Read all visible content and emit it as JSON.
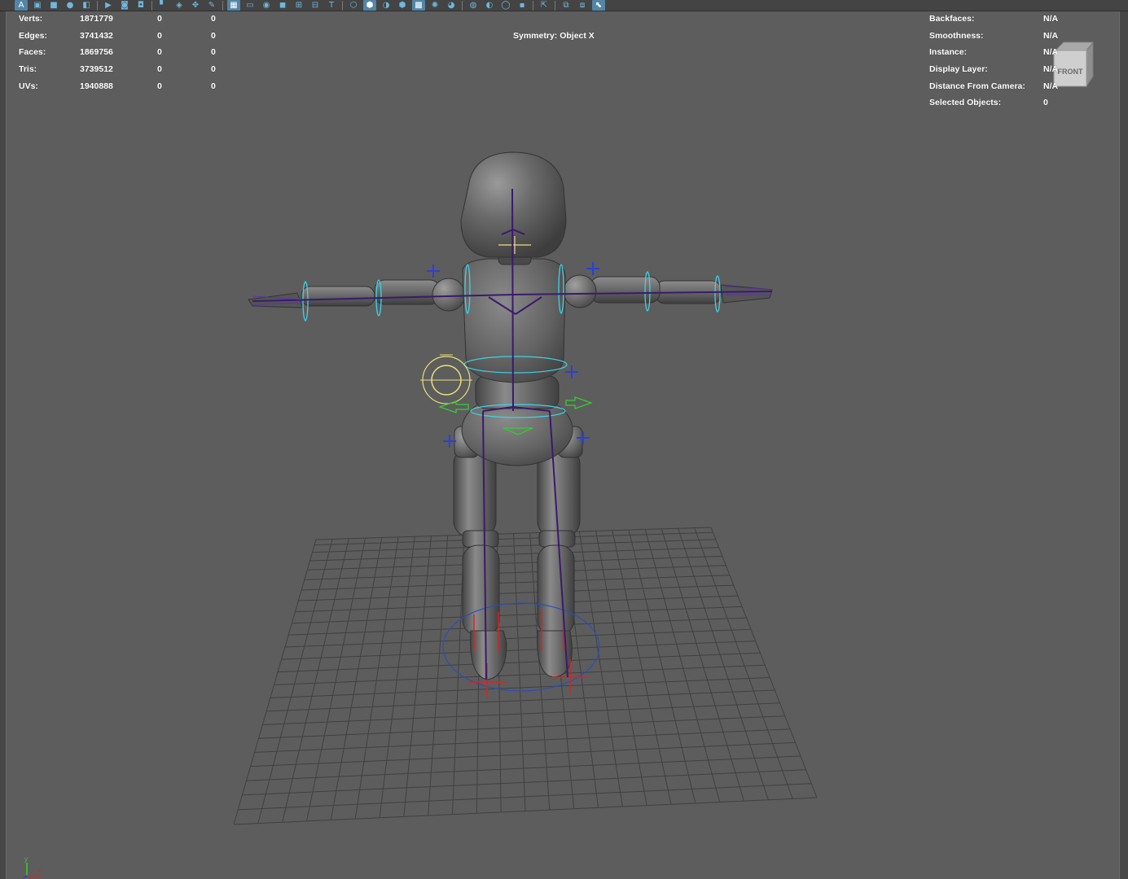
{
  "toolbar": {
    "buttons": [
      {
        "icon": "select-mode-icon",
        "glyph": "A",
        "active": true
      },
      {
        "icon": "frame-icon",
        "glyph": "▣",
        "active": false
      },
      {
        "icon": "panel-icon",
        "glyph": "■",
        "active": false
      },
      {
        "icon": "sphere-icon",
        "glyph": "●",
        "active": false
      },
      {
        "icon": "layers-icon",
        "glyph": "◧",
        "active": false
      },
      {
        "sep": true
      },
      {
        "icon": "camera-icon",
        "glyph": "▶",
        "active": false
      },
      {
        "icon": "camera-lock-icon",
        "glyph": "◙",
        "active": false
      },
      {
        "icon": "camera-attr-icon",
        "glyph": "◘",
        "active": false
      },
      {
        "sep": true
      },
      {
        "icon": "bookmark-icon",
        "glyph": "▘",
        "active": false
      },
      {
        "icon": "image-plane-icon",
        "glyph": "◈",
        "active": false
      },
      {
        "icon": "2d-pan-icon",
        "glyph": "✥",
        "active": false
      },
      {
        "icon": "grease-pencil-icon",
        "glyph": "✎",
        "active": false
      },
      {
        "sep": true
      },
      {
        "icon": "grid-icon",
        "glyph": "▦",
        "active": true
      },
      {
        "icon": "film-gate-icon",
        "glyph": "▭",
        "active": false
      },
      {
        "icon": "resolution-gate-icon",
        "glyph": "◉",
        "active": false
      },
      {
        "icon": "gate-mask-icon",
        "glyph": "◼",
        "active": false
      },
      {
        "icon": "field-chart-icon",
        "glyph": "⊞",
        "active": false
      },
      {
        "icon": "safe-action-icon",
        "glyph": "⊟",
        "active": false
      },
      {
        "icon": "safe-title-icon",
        "glyph": "T",
        "active": false
      },
      {
        "sep": true
      },
      {
        "icon": "wireframe-icon",
        "glyph": "⬡",
        "active": false
      },
      {
        "icon": "smooth-shade-icon",
        "glyph": "⬢",
        "active": true
      },
      {
        "icon": "wireframe-on-shaded-icon",
        "glyph": "◑",
        "active": false
      },
      {
        "icon": "textured-icon",
        "glyph": "⬢",
        "active": false
      },
      {
        "icon": "checker-icon",
        "glyph": "▩",
        "active": true
      },
      {
        "icon": "lights-icon",
        "glyph": "✺",
        "active": false
      },
      {
        "icon": "shadows-icon",
        "glyph": "◕",
        "active": false
      },
      {
        "sep": true
      },
      {
        "icon": "ambient-occlusion-icon",
        "glyph": "◍",
        "active": false
      },
      {
        "icon": "motion-blur-icon",
        "glyph": "◐",
        "active": false
      },
      {
        "icon": "anti-aliasing-icon",
        "glyph": "◯",
        "active": false
      },
      {
        "icon": "depth-of-field-icon",
        "glyph": "▪",
        "active": false
      },
      {
        "sep": true
      },
      {
        "icon": "isolate-select-icon",
        "glyph": "⇱",
        "active": false
      },
      {
        "sep": true
      },
      {
        "icon": "xray-icon",
        "glyph": "⧉",
        "active": false
      },
      {
        "icon": "xray-joints-icon",
        "glyph": "⧈",
        "active": false
      },
      {
        "icon": "xray-active-icon",
        "glyph": "⬉",
        "active": true
      }
    ]
  },
  "hud_left": {
    "rows": [
      {
        "label": "Verts:",
        "v1": "1871779",
        "v2": "0",
        "v3": "0"
      },
      {
        "label": "Edges:",
        "v1": "3741432",
        "v2": "0",
        "v3": "0"
      },
      {
        "label": "Faces:",
        "v1": "1869756",
        "v2": "0",
        "v3": "0"
      },
      {
        "label": "Tris:",
        "v1": "3739512",
        "v2": "0",
        "v3": "0"
      },
      {
        "label": "UVs:",
        "v1": "1940888",
        "v2": "0",
        "v3": "0"
      }
    ]
  },
  "symmetry": "Symmetry: Object X",
  "hud_right": {
    "rows": [
      {
        "label": "Backfaces:",
        "value": "N/A"
      },
      {
        "label": "Smoothness:",
        "value": "N/A"
      },
      {
        "label": "Instance:",
        "value": "N/A"
      },
      {
        "label": "Display Layer:",
        "value": "N/A"
      },
      {
        "label": "Distance From Camera:",
        "value": "N/A"
      },
      {
        "label": "Selected Objects:",
        "value": "0"
      }
    ]
  },
  "viewcube": {
    "face_label": "FRONT"
  },
  "axis": {
    "y": "y",
    "x": "x"
  },
  "colors": {
    "viewport_bg": "#5d5d5d",
    "grid": "#404040",
    "model": "#5a5a5a",
    "joint": "#3a1a6e",
    "control_cyan": "#3fd2e6",
    "control_yellow": "#e8e07a",
    "control_green": "#33d033",
    "control_red": "#e02020",
    "control_blue": "#2a3fd8"
  }
}
